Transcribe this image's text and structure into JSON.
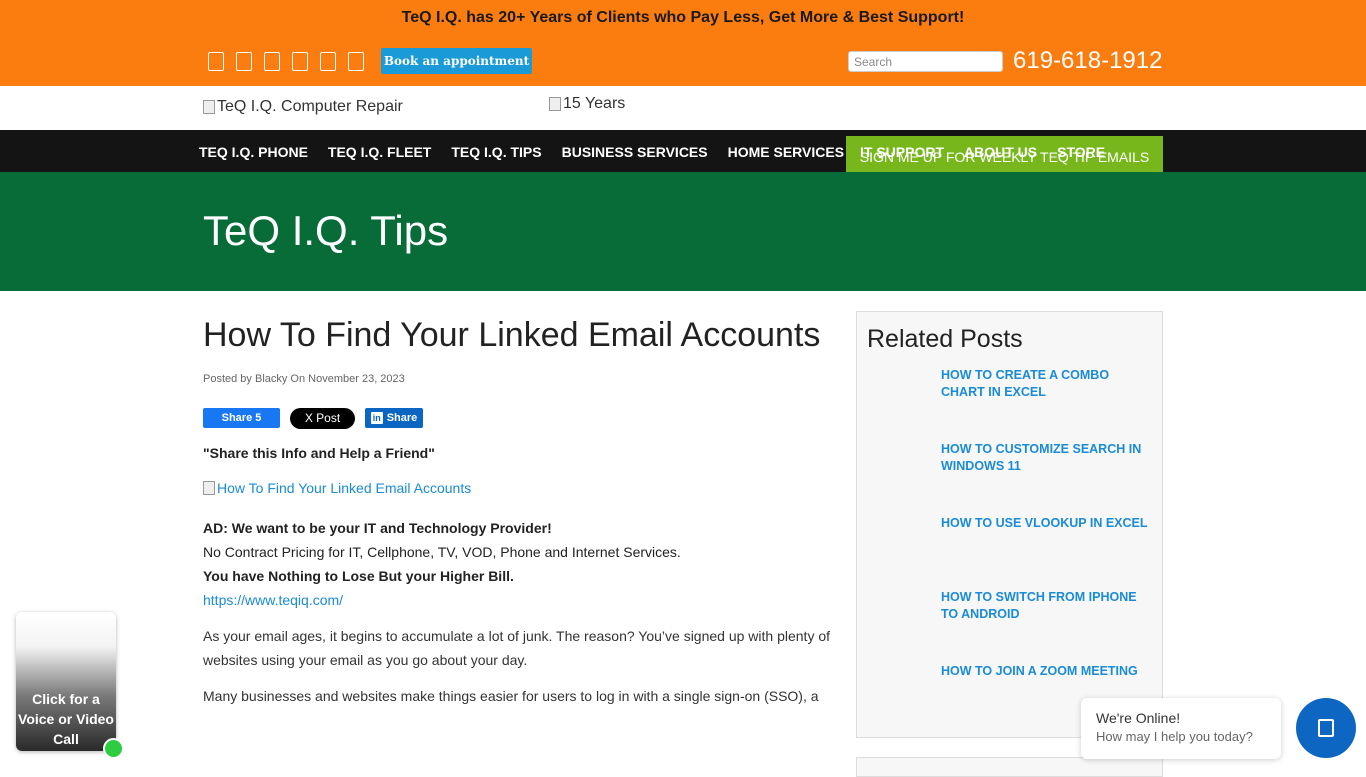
{
  "topbar": {
    "tagline": "TeQ I.Q. has 20+ Years of Clients who Pay Less, Get More & Best Support!",
    "social_icons": [
      "facebook-icon",
      "twitter-icon",
      "linkedin-icon",
      "youtube-icon",
      "instagram-icon",
      "pinterest-icon"
    ],
    "book_button": "Book an appointment",
    "search_placeholder": "Search",
    "phone": "619-618-1912"
  },
  "header": {
    "logo_alt": "TeQ I.Q. Computer Repair",
    "years_alt": "15 Years"
  },
  "nav": {
    "items": [
      "TEQ I.Q. PHONE",
      "TEQ I.Q. FLEET",
      "TEQ I.Q. TIPS",
      "BUSINESS SERVICES",
      "HOME SERVICES"
    ],
    "overlay_items": [
      "IT SUPPORT",
      "ABOUT US",
      "STORE"
    ],
    "signup": "SIGN ME UP FOR WEEKLY TEQ TIP EMAILS"
  },
  "banner": {
    "title": "TeQ I.Q. Tips"
  },
  "article": {
    "title": "How To Find Your Linked Email Accounts",
    "meta": "Posted by Blacky On November 23, 2023",
    "fb_share": "Share 5",
    "x_post": "X  Post",
    "li_share": "Share",
    "share_quote": "\"Share this Info and Help a Friend\"",
    "image_alt": "How To Find Your Linked Email Accounts",
    "ad_heading": "AD: We want to be your IT and Technology Provider!",
    "ad_line2": "No Contract Pricing for IT, Cellphone, TV, VOD, Phone and Internet Services.",
    "ad_line3": "You have Nothing to Lose But your Higher Bill.",
    "ad_link": "https://www.teqiq.com/",
    "para1": "As your email ages, it begins to accumulate a lot of junk. The reason? You’ve signed up with plenty of websites using your email as you go about your day.",
    "para2": "Many businesses and websites make things easier for users to log in with a single sign-on (SSO), a"
  },
  "sidebar": {
    "heading": "Related Posts",
    "posts": [
      "HOW TO CREATE A COMBO CHART IN EXCEL",
      "HOW TO CUSTOMIZE SEARCH IN WINDOWS 11",
      "HOW TO USE VLOOKUP IN EXCEL",
      "HOW TO SWITCH FROM IPHONE TO ANDROID",
      "HOW TO JOIN A ZOOM MEETING"
    ]
  },
  "video_widget": {
    "text": "Click for a Voice or Video Call"
  },
  "chat": {
    "title": "We're Online!",
    "subtitle": "How may I help you today?"
  }
}
